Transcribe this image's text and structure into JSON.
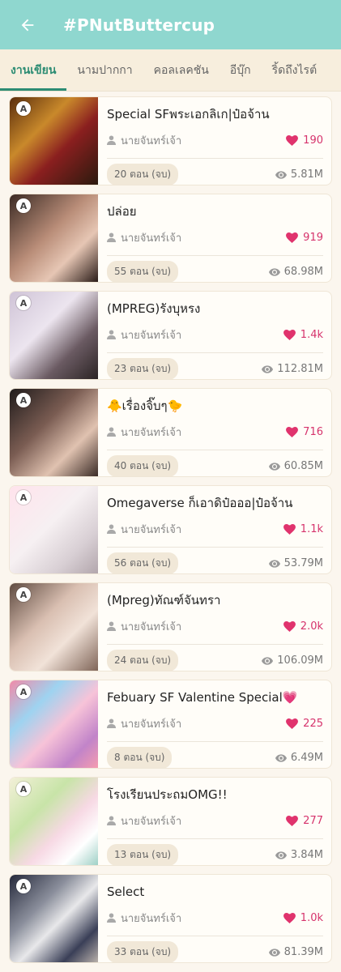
{
  "appbar": {
    "title": "#PNutButtercup",
    "back_icon": "arrow-left-icon"
  },
  "tabs": [
    {
      "label": "งานเขียน",
      "active": true
    },
    {
      "label": "นามปากกา",
      "active": false
    },
    {
      "label": "คอลเลคชัน",
      "active": false
    },
    {
      "label": "อีบุ๊ก",
      "active": false
    },
    {
      "label": "ริ้ดถึงไรต์",
      "active": false
    }
  ],
  "colors": {
    "appbar": "#8fd7cf",
    "accent": "#2c8c73",
    "heart": "#d6336c"
  },
  "novels": [
    {
      "badge": "A",
      "title": "Special SFพระเอกลิเก|ป๋อจ้าน",
      "author": "นายจันทร์เจ้า",
      "likes": "190",
      "episodes": "20 ตอน (จบ)",
      "views": "5.81M"
    },
    {
      "badge": "A",
      "title": "ปล่อย",
      "author": "นายจันทร์เจ้า",
      "likes": "919",
      "episodes": "55 ตอน (จบ)",
      "views": "68.98M"
    },
    {
      "badge": "A",
      "title": "(MPREG)รังบุหรง",
      "author": "นายจันทร์เจ้า",
      "likes": "1.4k",
      "episodes": "23 ตอน (จบ)",
      "views": "112.81M"
    },
    {
      "badge": "A",
      "title": "🐥เรื่องจิ๊บๆ🐤",
      "author": "นายจันทร์เจ้า",
      "likes": "716",
      "episodes": "40 ตอน (จบ)",
      "views": "60.85M"
    },
    {
      "badge": "A",
      "title": "Omegaverse ก็เอาดิป๋อออ|ป๋อจ้าน",
      "author": "นายจันทร์เจ้า",
      "likes": "1.1k",
      "episodes": "56 ตอน (จบ)",
      "views": "53.79M"
    },
    {
      "badge": "A",
      "title": "(Mpreg)ทัณฑ์จันทรา",
      "author": "นายจันทร์เจ้า",
      "likes": "2.0k",
      "episodes": "24 ตอน (จบ)",
      "views": "106.09M"
    },
    {
      "badge": "A",
      "title": "Febuary SF  Valentine Special💗",
      "author": "นายจันทร์เจ้า",
      "likes": "225",
      "episodes": "8 ตอน (จบ)",
      "views": "6.49M"
    },
    {
      "badge": "A",
      "title": "โรงเรียนประถมOMG!!",
      "author": "นายจันทร์เจ้า",
      "likes": "277",
      "episodes": "13 ตอน (จบ)",
      "views": "3.84M"
    },
    {
      "badge": "A",
      "title": "Select",
      "author": "นายจันทร์เจ้า",
      "likes": "1.0k",
      "episodes": "33 ตอน (จบ)",
      "views": "81.39M"
    }
  ]
}
